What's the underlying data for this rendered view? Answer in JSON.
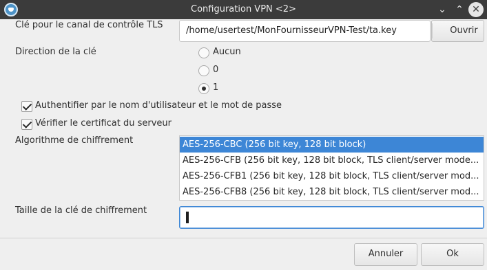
{
  "window": {
    "title": "Configuration VPN <2>",
    "minimize_glyph": "⌄",
    "maximize_glyph": "⌃",
    "close_glyph": "✕"
  },
  "tls_key": {
    "label": "Clé pour le canal de contrôle TLS",
    "path": "/home/usertest/MonFournisseurVPN-Test/ta.key",
    "open_button": "Ouvrir"
  },
  "key_direction": {
    "label": "Direction de la clé",
    "options": [
      {
        "label": "Aucun",
        "selected": false
      },
      {
        "label": "0",
        "selected": false
      },
      {
        "label": "1",
        "selected": true
      }
    ]
  },
  "checkboxes": [
    {
      "label": "Authentifier par le nom d'utilisateur et le mot de passe",
      "checked": true
    },
    {
      "label": "Vérifier le certificat du serveur",
      "checked": true
    }
  ],
  "cipher": {
    "label": "Algorithme de chiffrement",
    "items": [
      {
        "label": "AES-256-CBC  (256 bit key, 128 bit block)",
        "selected": true
      },
      {
        "label": "AES-256-CFB  (256 bit key, 128 bit block, TLS client/server mode...",
        "selected": false
      },
      {
        "label": "AES-256-CFB1  (256 bit key, 128 bit block, TLS client/server mod...",
        "selected": false
      },
      {
        "label": "AES-256-CFB8  (256 bit key, 128 bit block, TLS client/server mod...",
        "selected": false
      }
    ]
  },
  "key_size": {
    "label": "Taille de la clé de chiffrement",
    "value": ""
  },
  "footer": {
    "cancel": "Annuler",
    "ok": "Ok"
  },
  "colors": {
    "titlebar": "#3b3b3b",
    "accent": "#3d86d6",
    "background": "#efefef"
  },
  "icons": {
    "app": "vpn-shield-icon"
  }
}
